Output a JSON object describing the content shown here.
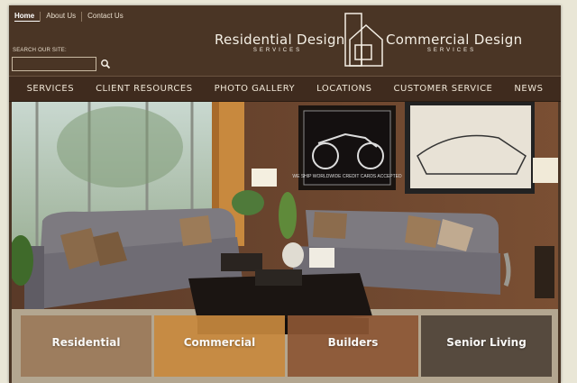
{
  "top_links": [
    "Home",
    "About Us",
    "Contact Us"
  ],
  "search": {
    "label": "SEARCH OUR SITE:",
    "value": ""
  },
  "brand_left": {
    "main": "Residential Design",
    "sub": "SERVICES"
  },
  "brand_right": {
    "main": "Commercial Design",
    "sub": "SERVICES"
  },
  "nav": [
    "SERVICES",
    "CLIENT RESOURCES",
    "PHOTO GALLERY",
    "LOCATIONS",
    "CUSTOMER SERVICE",
    "NEWS"
  ],
  "art": {
    "caption": "WE SHIP WORLDWIDE CREDIT CARDS ACCEPTED"
  },
  "tiles": [
    {
      "label": "Residential",
      "color": "#9c7a5a"
    },
    {
      "label": "Commercial",
      "color": "#c8893e"
    },
    {
      "label": "Builders",
      "color": "#8c5634"
    },
    {
      "label": "Senior Living",
      "color": "#4f4338"
    }
  ]
}
